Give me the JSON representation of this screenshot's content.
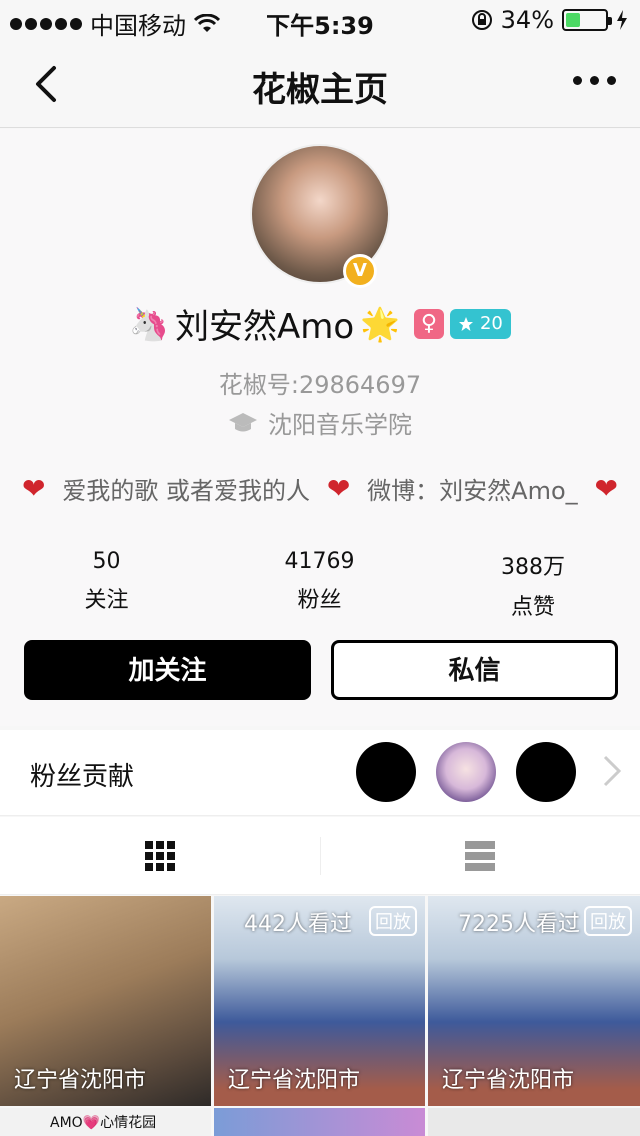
{
  "status_bar": {
    "carrier": "中国移动",
    "time": "下午5:39",
    "battery": "34%"
  },
  "nav": {
    "title": "花椒主页"
  },
  "profile": {
    "name": "刘安然Amo",
    "emoji_before": "🦄",
    "emoji_after": "🌟",
    "verified_badge": "V",
    "gender_symbol": "♀",
    "level": "20",
    "huajiao_id": "花椒号:29864697",
    "school": "沈阳音乐学院",
    "bio": "爱我的歌 或者爱我的人",
    "bio_weibo": "微博：刘安然Amo_",
    "stats": [
      {
        "value": "50",
        "label": "关注"
      },
      {
        "value": "41769",
        "label": "粉丝"
      },
      {
        "value": "388万",
        "label": "点赞"
      }
    ],
    "follow_button": "加关注",
    "message_button": "私信"
  },
  "fans": {
    "label": "粉丝贡献"
  },
  "thumbnails": [
    {
      "views": "",
      "replay": "",
      "location": "辽宁省沈阳市"
    },
    {
      "views": "442人看过",
      "replay": "回放",
      "location": "辽宁省沈阳市"
    },
    {
      "views": "7225人看过",
      "replay": "回放",
      "location": "辽宁省沈阳市"
    }
  ],
  "row2": {
    "first_caption": "AMO💗心情花园"
  },
  "colors": {
    "gender_pink": "#f06785",
    "level_teal": "#34c3d0",
    "verified_gold": "#f2b01e",
    "heart_red": "#d0252d"
  }
}
